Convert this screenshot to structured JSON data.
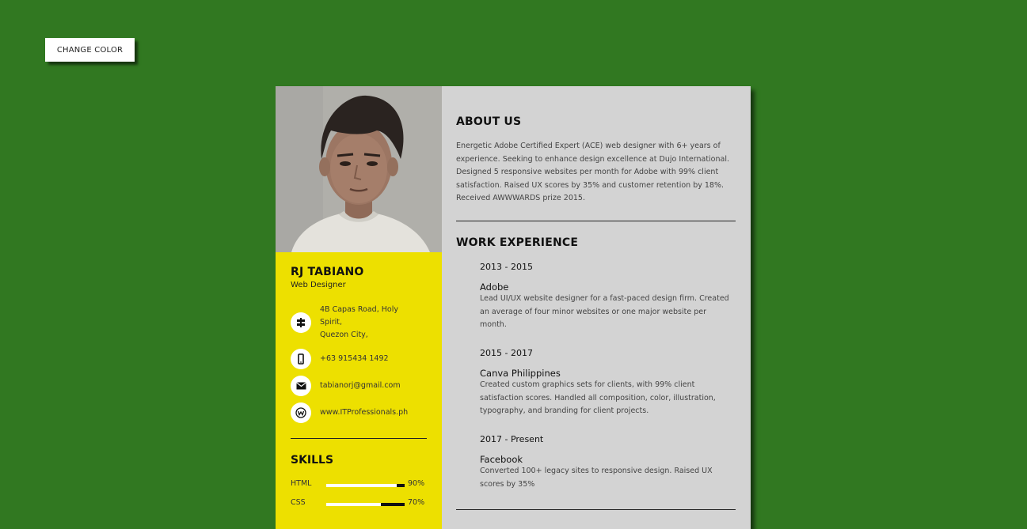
{
  "change_color_label": "CHANGE COLOR",
  "profile": {
    "name": "RJ TABIANO",
    "role": "Web Designer"
  },
  "contacts": [
    {
      "icon": "signpost-icon",
      "lines": [
        "4B Capas Road, Holy",
        "Spirit,",
        "Quezon City,"
      ]
    },
    {
      "icon": "mobile-phone-icon",
      "lines": [
        "+63 915434 1492"
      ]
    },
    {
      "icon": "envelope-icon",
      "lines": [
        "tabianorj@gmail.com"
      ]
    },
    {
      "icon": "weebly-icon",
      "lines": [
        "www.ITProfessionals.ph"
      ]
    }
  ],
  "skills": {
    "title": "SKILLS",
    "items": [
      {
        "label": "HTML",
        "percent": 90,
        "display": "90%"
      },
      {
        "label": "CSS",
        "percent": 70,
        "display": "70%"
      }
    ]
  },
  "about": {
    "title": "ABOUT US",
    "text": "Energetic Adobe Certified Expert (ACE) web designer with 6+ years of experience. Seeking to enhance design excellence at Dujo International. Designed 5 responsive websites per month for Adobe with 99% client satisfaction. Raised UX scores by 35% and customer retention by 18%. Received AWWWARDS prize 2015."
  },
  "work": {
    "title": "WORK EXPERIENCE",
    "jobs": [
      {
        "years": "2013 - 2015",
        "company": "Adobe",
        "description": "Lead UI/UX website designer for a fast-paced design firm. Created an average of four minor websites or one major website per month."
      },
      {
        "years": "2015 - 2017",
        "company": "Canva Philippines",
        "description": "Created custom graphics sets for clients, with 99% client satisfaction scores. Handled all composition, color, illustration, typography, and branding for client projects."
      },
      {
        "years": "2017 - Present",
        "company": "Facebook",
        "description": "Converted 100+ legacy sites to responsive design. Raised UX scores by 35%"
      }
    ]
  },
  "colors": {
    "background": "#317821",
    "sidebar": "#ede000",
    "main_panel": "#d3d3d3"
  }
}
